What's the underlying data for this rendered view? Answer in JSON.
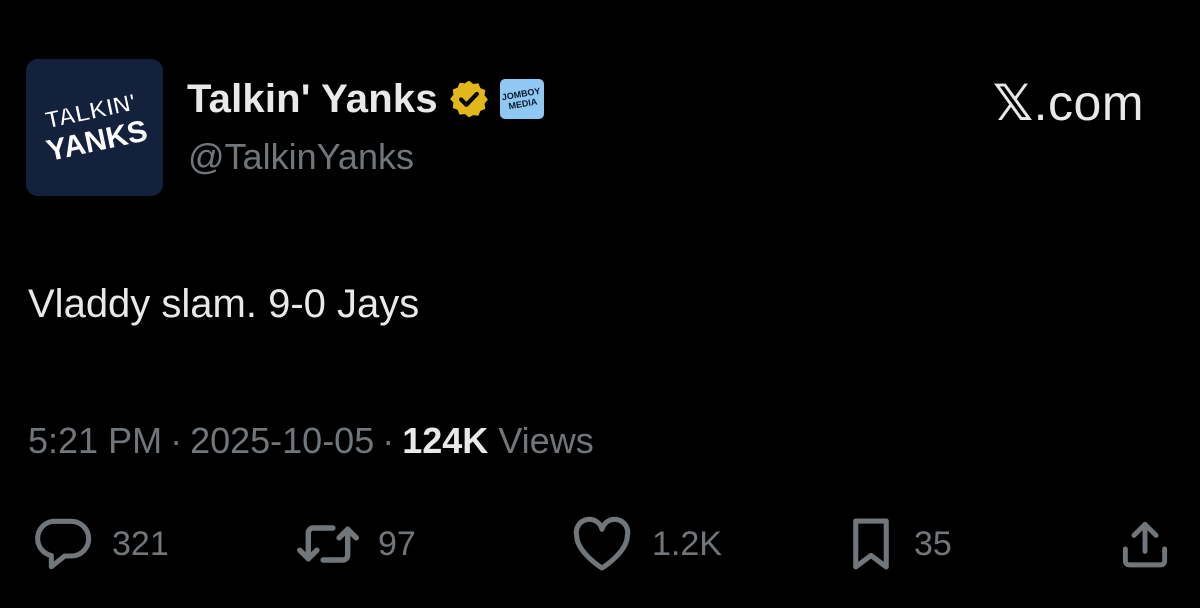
{
  "account": {
    "display_name": "Talkin' Yanks",
    "handle": "@TalkinYanks",
    "avatar_text_line1": "TALKIN'",
    "avatar_text_line2": "YANKS",
    "affiliate_badge_text": "JOMBOY MEDIA",
    "verified": true
  },
  "brand": {
    "x_glyph": "𝕏",
    "suffix": ".com"
  },
  "tweet": {
    "text": "Vladdy slam. 9-0 Jays",
    "time": "5:21 PM",
    "date": "2025-10-05",
    "separator": "·",
    "views_count": "124K",
    "views_label": "Views"
  },
  "actions": {
    "replies": "321",
    "reposts": "97",
    "likes": "1.2K",
    "bookmarks": "35"
  },
  "colors": {
    "background": "#000000",
    "primary_text": "#e7e9ea",
    "secondary_text": "#71767b",
    "verified_gold": "#e2b719",
    "avatar_bg": "#14213d",
    "affiliate_bg": "#8fc8f2"
  }
}
